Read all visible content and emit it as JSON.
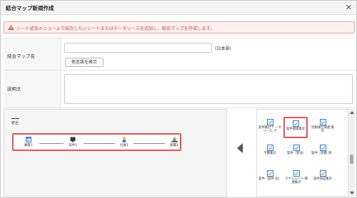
{
  "dialog": {
    "title": "結合マップ新規作成"
  },
  "alert": {
    "message": "シート追加メニューより結合したいシートまたはデータソースを追加し、結合マップを作成します。"
  },
  "form": {
    "name_label": "結合マップ名",
    "name_value": "",
    "lang_note": "(日本語)",
    "other_lang_button": "他言語を表示",
    "desc_label": "説明文",
    "desc_value": ""
  },
  "canvas": {
    "main_node_label": "結合",
    "flow": [
      {
        "label": "顧客1",
        "icon": "table-icon"
      },
      {
        "label": "案件1",
        "icon": "monitor-icon"
      },
      {
        "label": "社員1",
        "icon": "person-icon"
      },
      {
        "label": "部署1",
        "icon": "org-icon"
      }
    ]
  },
  "palette": {
    "items": [
      {
        "label": "案件集計デ ータソース_デ",
        "selected": false
      },
      {
        "label": "案件関連集計",
        "selected": true
      },
      {
        "label": "活動報告関連 集計",
        "selected": false
      },
      {
        "label": "予算集計",
        "selected": false
      },
      {
        "label": "案件（受注）",
        "selected": false
      },
      {
        "label": "案件（見積 済）",
        "selected": false
      },
      {
        "label": "案件（案件 化）",
        "selected": false
      },
      {
        "label": "スケジュール 関連集計",
        "selected": false
      },
      {
        "label": "案件商品集計",
        "selected": false
      }
    ]
  },
  "colors": {
    "accent_red": "#e0545a",
    "alert_text": "#d2453a",
    "tile_blue": "#2f7fd0"
  }
}
